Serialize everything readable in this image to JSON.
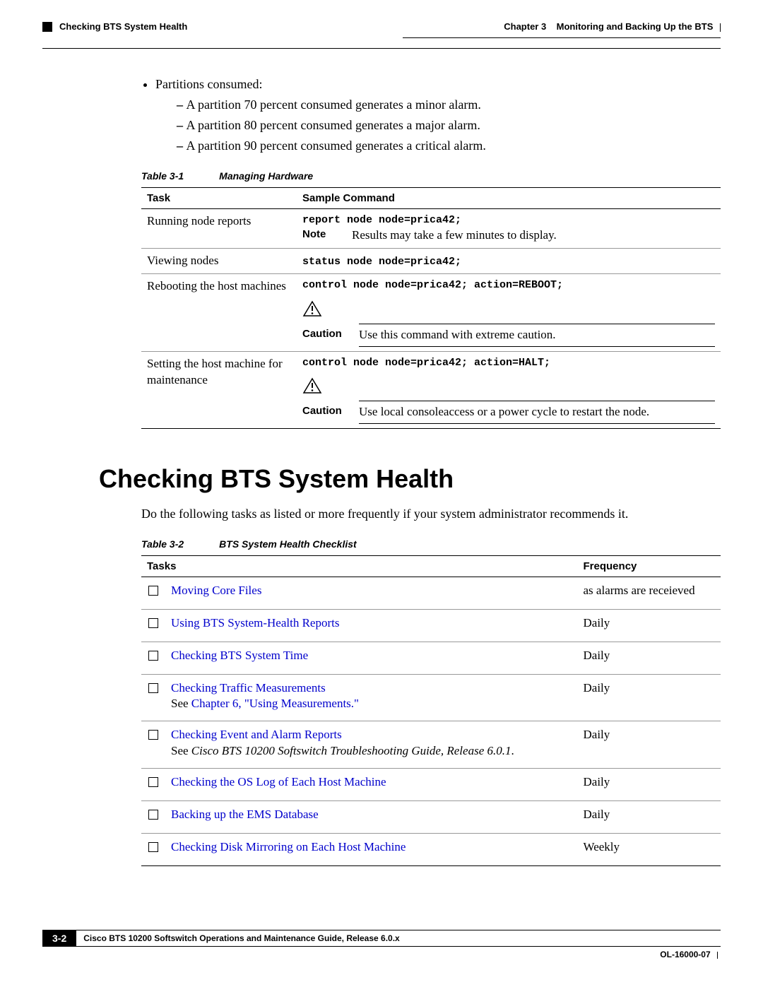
{
  "header": {
    "chapter_label": "Chapter 3",
    "chapter_title": "Monitoring and Backing Up the BTS",
    "section_title": "Checking BTS System Health"
  },
  "bullets": {
    "lead": "Partitions consumed:",
    "items": [
      "A partition 70 percent consumed generates a minor alarm.",
      "A partition 80 percent consumed generates a major alarm.",
      "A partition 90 percent consumed generates a critical alarm."
    ]
  },
  "table1": {
    "caption_num": "Table 3-1",
    "caption_title": "Managing Hardware",
    "headers": [
      "Task",
      "Sample Command"
    ],
    "rows": [
      {
        "task": "Running node reports",
        "cmd": "report node node=prica42;",
        "note_label": "Note",
        "note_text": "Results may take a few minutes to display."
      },
      {
        "task": "Viewing nodes",
        "cmd": "status node node=prica42;"
      },
      {
        "task": "Rebooting the host machines",
        "cmd": "control node node=prica42; action=REBOOT;",
        "caution_label": "Caution",
        "caution_text": "Use this command with extreme caution."
      },
      {
        "task": "Setting the host machine for maintenance",
        "cmd": "control node node=prica42; action=HALT;",
        "caution_label": "Caution",
        "caution_text": "Use local consoleaccess or a power cycle to restart the node."
      }
    ]
  },
  "section_heading": "Checking BTS System Health",
  "section_intro": "Do the following tasks as listed or more frequently if your system administrator recommends it.",
  "table2": {
    "caption_num": "Table 3-2",
    "caption_title": "BTS System Health Checklist",
    "headers": [
      "Tasks",
      "Frequency"
    ],
    "rows": [
      {
        "link": "Moving Core Files",
        "freq": "as alarms are receieved"
      },
      {
        "link": "Using BTS System-Health Reports",
        "freq": "Daily"
      },
      {
        "link": "Checking BTS System Time",
        "freq": "Daily"
      },
      {
        "link": "Checking Traffic Measurements",
        "extra_prefix": "See ",
        "extra_link": "Chapter 6, \"Using Measurements.\"",
        "freq": "Daily"
      },
      {
        "link": "Checking Event and Alarm Reports",
        "extra_prefix": "See ",
        "extra_italic": "Cisco BTS 10200 Softswitch Troubleshooting Guide, Release 6.0.1",
        "extra_suffix": ".",
        "freq": "Daily"
      },
      {
        "link": "Checking the OS Log of Each Host Machine",
        "freq": "Daily"
      },
      {
        "link": "Backing up the EMS Database",
        "freq": "Daily"
      },
      {
        "link": "Checking Disk Mirroring on Each Host Machine",
        "freq": "Weekly"
      }
    ]
  },
  "footer": {
    "page": "3-2",
    "book": "Cisco BTS 10200 Softswitch Operations and Maintenance Guide, Release 6.0.x",
    "doc_id": "OL-16000-07"
  }
}
